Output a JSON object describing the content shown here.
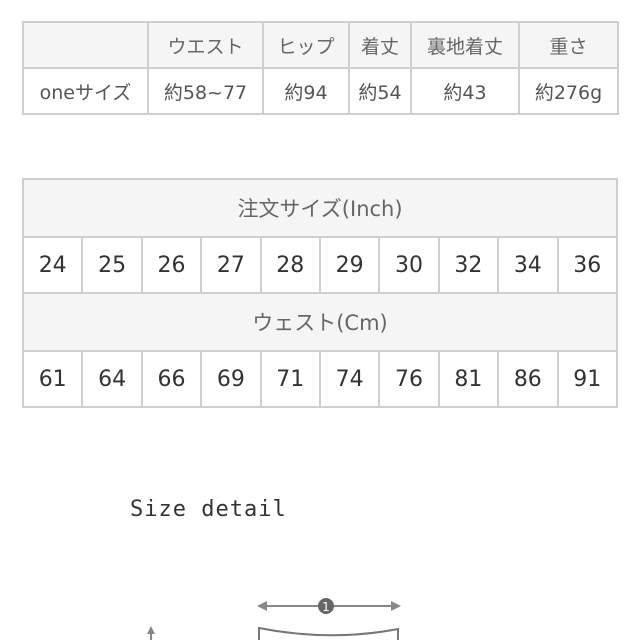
{
  "table1": {
    "headers": [
      "",
      "ウエスト",
      "ヒップ",
      "着丈",
      "裏地着丈",
      "重さ"
    ],
    "row": [
      "oneサイズ",
      "約58~77",
      "約94",
      "約54",
      "約43",
      "約276g"
    ]
  },
  "table2": {
    "order_size_label": "注文サイズ(Inch)",
    "inch_sizes": [
      "24",
      "25",
      "26",
      "27",
      "28",
      "29",
      "30",
      "32",
      "34",
      "36"
    ],
    "waist_label": "ウェスト(Cm)",
    "waist_cm": [
      "61",
      "64",
      "66",
      "69",
      "71",
      "74",
      "76",
      "81",
      "86",
      "91"
    ]
  },
  "size_detail": {
    "title": "Size detail",
    "marker_label": "1"
  }
}
